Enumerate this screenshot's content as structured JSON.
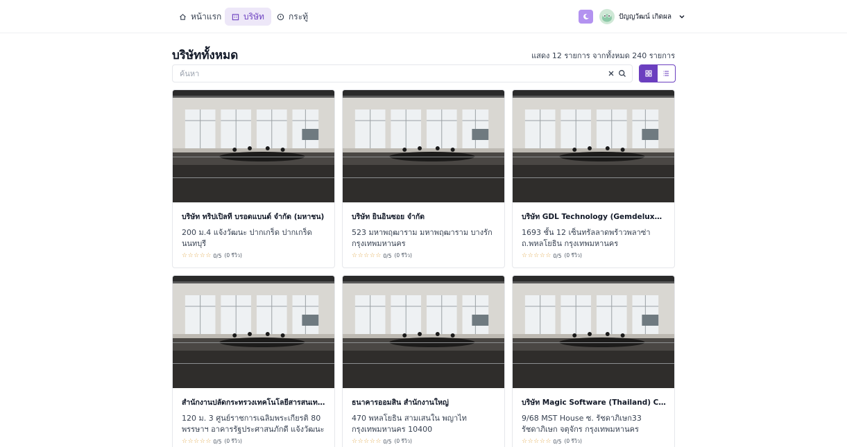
{
  "nav": {
    "items": [
      {
        "label": "หน้าแรก",
        "icon": "home-icon"
      },
      {
        "label": "บริษัท",
        "icon": "building-icon",
        "active": true
      },
      {
        "label": "กระทู้",
        "icon": "help-circle-icon"
      }
    ],
    "theme_toggle_icon": "moon-icon",
    "user_name": "ปัญญวัฒน์ เกิดผล"
  },
  "page": {
    "title": "บริษัททั้งหมด",
    "count_text": "แสดง 12 รายการ จากทั้งหมด 240 รายการ"
  },
  "search": {
    "placeholder": "ค้นหา",
    "value": ""
  },
  "view": {
    "mode": "grid"
  },
  "colors": {
    "accent": "#6b3fbf",
    "accent_light": "#ede7f8",
    "star": "#e0a84b"
  },
  "companies": [
    {
      "name": "บริษัท ทริปเปิลที บรอดแบนด์ จำกัด (มหาชน)",
      "address": "200 ม.4 แจ้งวัฒนะ ปากเกร็ด ปากเกร็ด นนทบุรี",
      "rating": "0/5",
      "reviews": "(0 รีวิว)",
      "stars": 5
    },
    {
      "name": "บริษัท ยินอินซอย จำกัด",
      "address": "523 มหาพฤฒาราม มหาพฤฒาราม บางรัก กรุงเทพมหานคร",
      "rating": "0/5",
      "reviews": "(0 รีวิว)",
      "stars": 5
    },
    {
      "name": "บริษัท GDL Technology (Gemdeluxe.Com)",
      "address": "1693 ชั้น 12 เซ็นทรัลลาดพร้าวพลาซ่า ถ.พหลโยธิน กรุงเทพมหานคร",
      "rating": "0/5",
      "reviews": "(0 รีวิว)",
      "stars": 5
    },
    {
      "name": "สำนักงานปลัดกระทรวงเทคโนโลยีสารสนเทศและการสื่อสาร",
      "address": "120 ม. 3 ศูนย์ราชการเฉลิมพระเกียรติ 80 พรรษาฯ อาคารรัฐประศาสนภักดี แจ้งวัฒนะ",
      "rating": "0/5",
      "reviews": "(0 รีวิว)",
      "stars": 5
    },
    {
      "name": "ธนาคารออมสิน สำนักงานใหญ่",
      "address": "470 พหลโยธิน สามเสนใน พญาไท กรุงเทพมหานคร 10400",
      "rating": "0/5",
      "reviews": "(0 รีวิว)",
      "stars": 5
    },
    {
      "name": "บริษัท Magic Software (Thailand) Corp., Ltd.",
      "address": "9/68 MST House ซ. รัชดาภิเษก33 รัชดาภิเษก จตุจักร กรุงเทพมหานคร",
      "rating": "0/5",
      "reviews": "(0 รีวิว)",
      "stars": 5
    }
  ]
}
